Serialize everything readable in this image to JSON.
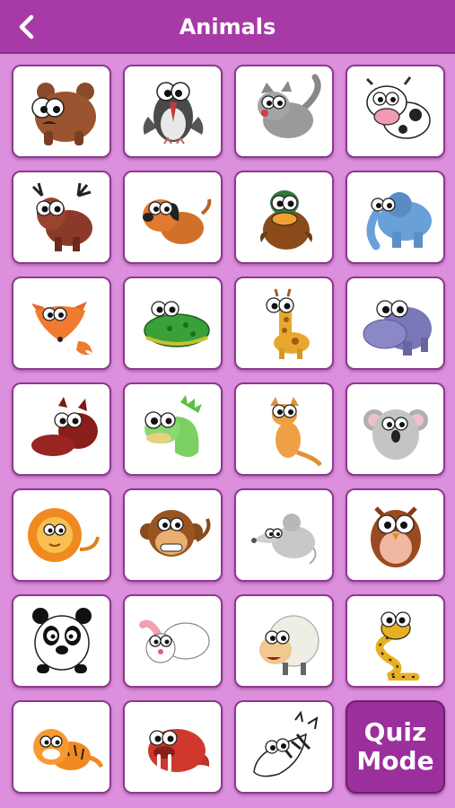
{
  "header": {
    "title": "Animals",
    "back_icon": "chevron-left-icon"
  },
  "colors": {
    "background": "#dc8fdd",
    "header": "#a83aa8",
    "tile_border": "#8b3a8d",
    "quiz_button": "#9b2f9c"
  },
  "animals": [
    "bear",
    "woodpecker",
    "cat",
    "cow",
    "moose",
    "dog",
    "duck",
    "elephant",
    "fox",
    "frog",
    "giraffe",
    "hippo",
    "boar",
    "iguana",
    "kangaroo",
    "koala",
    "lion",
    "monkey",
    "mouse",
    "owl",
    "panda",
    "rabbit",
    "sheep",
    "snake",
    "tiger",
    "walrus",
    "zebra"
  ],
  "quiz": {
    "line1": "Quiz",
    "line2": "Mode"
  }
}
